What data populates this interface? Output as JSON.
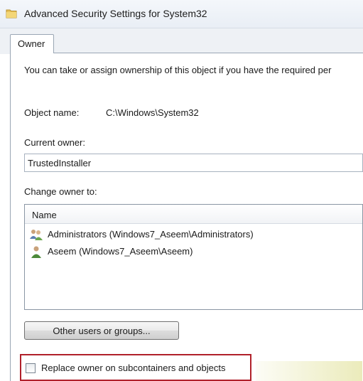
{
  "window": {
    "title": "Advanced Security Settings for System32",
    "title_icon": "folder-icon"
  },
  "tabs": [
    {
      "label": "Owner",
      "active": true
    }
  ],
  "owner_page": {
    "intro_text": "You can take or assign ownership of this object if you have the required per",
    "object_name_label": "Object name:",
    "object_name_value": "C:\\Windows\\System32",
    "current_owner_label": "Current owner:",
    "current_owner_value": "TrustedInstaller",
    "change_owner_label": "Change owner to:",
    "list": {
      "column_header": "Name",
      "items": [
        {
          "label": "Administrators (Windows7_Aseem\\Administrators)",
          "icon": "user-group-icon"
        },
        {
          "label": "Aseem (Windows7_Aseem\\Aseem)",
          "icon": "user-icon"
        }
      ]
    },
    "other_users_button": "Other users or groups...",
    "replace_checkbox_label": "Replace owner on subcontainers and objects",
    "replace_checkbox_checked": false,
    "highlight_color": "#b0202a"
  }
}
